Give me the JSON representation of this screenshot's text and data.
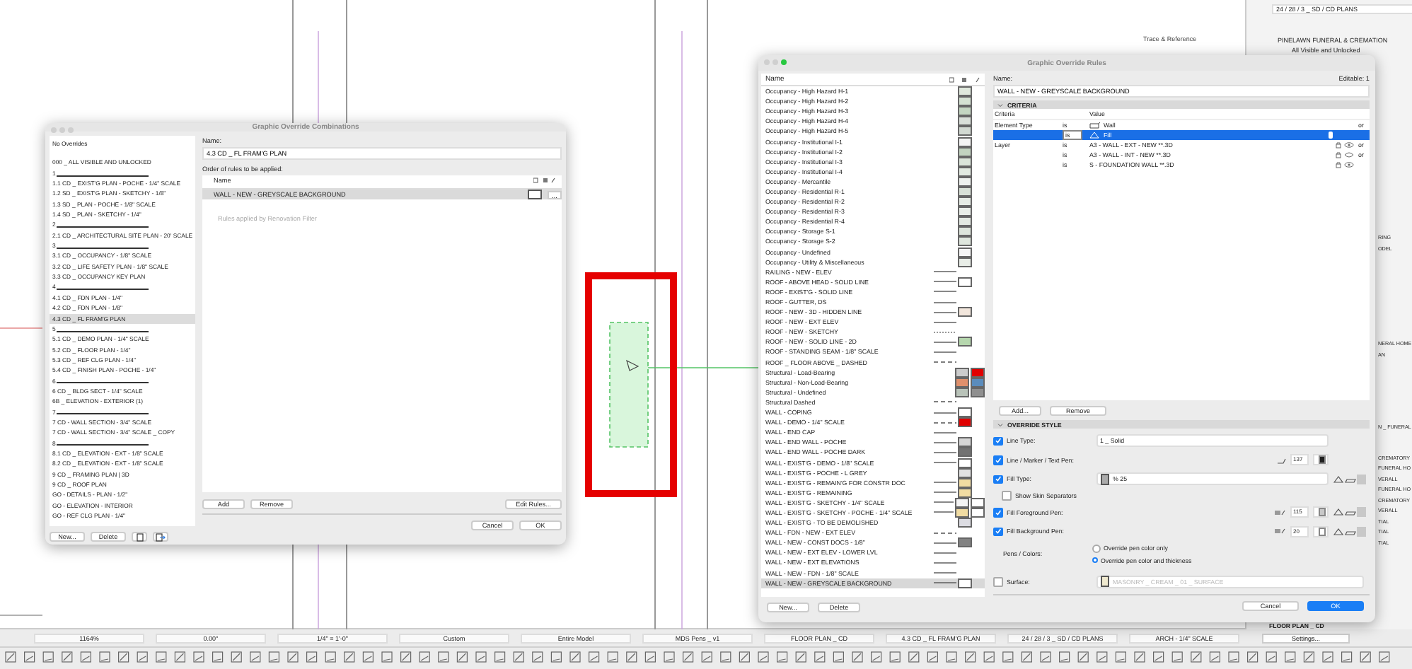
{
  "toolbar_top": {
    "label": "Trace & Reference"
  },
  "navigator": {
    "path": "24 / 28 / 3 _ SD / CD PLANS",
    "project": "PINELAWN FUNERAL & CREMATION",
    "combination": "All Visible and Unlocked",
    "cut_groups": [
      [
        "RING",
        "ODEL"
      ],
      [
        "NERAL HOME",
        "AN"
      ],
      [
        "N _ FUNERAL"
      ],
      [
        "CREMATORY",
        "FUNERAL HO",
        "VERALL",
        "FUNERAL HO",
        "CREMATORY",
        "VERALL",
        "TIAL",
        "TIAL",
        "TIAL"
      ]
    ],
    "view": "FLOOR PLAN _ CD",
    "settings": "Settings..."
  },
  "combinations": {
    "title": "Graphic Override Combinations",
    "no_overrides": "No Overrides",
    "items": [
      {
        "kind": "item",
        "label": "000 _ ALL VISIBLE AND UNLOCKED",
        "selected": false
      },
      {
        "kind": "separator",
        "label": "1",
        "selected": false
      },
      {
        "kind": "item",
        "label": "1.1 CD _ EXIST'G PLAN - POCHE - 1/4\" SCALE",
        "selected": false
      },
      {
        "kind": "item",
        "label": "1.2 SD _ EXIST'G PLAN - SKETCHY - 1/8\"",
        "selected": false
      },
      {
        "kind": "item",
        "label": "1.3 SD _ PLAN - POCHE - 1/8\" SCALE",
        "selected": false
      },
      {
        "kind": "item",
        "label": "1.4 SD _ PLAN - SKETCHY - 1/4\"",
        "selected": false
      },
      {
        "kind": "separator",
        "label": "2",
        "selected": false
      },
      {
        "kind": "item",
        "label": "2.1 CD _ ARCHITECTURAL SITE PLAN - 20' SCALE",
        "selected": false
      },
      {
        "kind": "separator",
        "label": "3",
        "selected": false
      },
      {
        "kind": "item",
        "label": "3.1 CD _ OCCUPANCY - 1/8\" SCALE",
        "selected": false
      },
      {
        "kind": "item",
        "label": "3.2 CD _ LIFE SAFETY PLAN - 1/8\" SCALE",
        "selected": false
      },
      {
        "kind": "item",
        "label": "3.3 CD _ OCCUPANCY KEY PLAN",
        "selected": false
      },
      {
        "kind": "separator",
        "label": "4",
        "selected": false
      },
      {
        "kind": "item",
        "label": "4.1 CD _ FDN PLAN - 1/4\"",
        "selected": false
      },
      {
        "kind": "item",
        "label": "4.2 CD _ FDN PLAN - 1/8\"",
        "selected": false
      },
      {
        "kind": "item",
        "label": "4.3 CD _ FL FRAM'G PLAN",
        "selected": true
      },
      {
        "kind": "separator",
        "label": "5",
        "selected": false
      },
      {
        "kind": "item",
        "label": "5.1 CD _ DEMO PLAN - 1/4\" SCALE",
        "selected": false
      },
      {
        "kind": "item",
        "label": "5.2 CD _ FLOOR PLAN - 1/4\"",
        "selected": false
      },
      {
        "kind": "item",
        "label": "5.3 CD _ REF CLG PLAN - 1/4\"",
        "selected": false
      },
      {
        "kind": "item",
        "label": "5.4 CD _ FINISH PLAN - POCHE - 1/4\"",
        "selected": false
      },
      {
        "kind": "separator",
        "label": "6",
        "selected": false
      },
      {
        "kind": "item",
        "label": "6 CD _ BLDG SECT - 1/4\" SCALE",
        "selected": false
      },
      {
        "kind": "item",
        "label": "6B _ ELEVATION - EXTERIOR (1)",
        "selected": false
      },
      {
        "kind": "separator",
        "label": "7",
        "selected": false
      },
      {
        "kind": "item",
        "label": "7 CD - WALL SECTION - 3/4\" SCALE",
        "selected": false
      },
      {
        "kind": "item",
        "label": "7 CD - WALL SECTION - 3/4\" SCALE _ COPY",
        "selected": false
      },
      {
        "kind": "separator",
        "label": "8",
        "selected": false
      },
      {
        "kind": "item",
        "label": "8.1 CD _ ELEVATION - EXT - 1/8\" SCALE",
        "selected": false
      },
      {
        "kind": "item",
        "label": "8.2 CD _ ELEVATION - EXT - 1/8\" SCALE",
        "selected": false
      },
      {
        "kind": "item",
        "label": "9 CD _ FRAMING PLAN | 3D",
        "selected": false
      },
      {
        "kind": "item",
        "label": "9 CD _ ROOF PLAN",
        "selected": false
      },
      {
        "kind": "item",
        "label": "GO - DETAILS - PLAN - 1/2\"",
        "selected": false
      },
      {
        "kind": "item",
        "label": "GO - ELEVATION - INTERIOR",
        "selected": false
      },
      {
        "kind": "item",
        "label": "GO - REF CLG PLAN - 1/4\"",
        "selected": false
      }
    ],
    "new": "New...",
    "delete": "Delete",
    "name_label": "Name:",
    "name_value": "4.3 CD _ FL FRAM'G PLAN",
    "order_label": "Order of rules to be applied:",
    "column": "Name",
    "rules": [
      {
        "name": "WALL - NEW - GREYSCALE BACKGROUND",
        "selected": true
      }
    ],
    "more": "...",
    "note": "Rules applied by Renovation Filter",
    "add": "Add",
    "remove": "Remove",
    "edit": "Edit Rules...",
    "cancel": "Cancel",
    "ok": "OK"
  },
  "rules_dialog": {
    "title": "Graphic Override Rules",
    "column": "Name",
    "items": [
      {
        "name": "Occupancy - High Hazard H-1",
        "kind": "fill",
        "swatches": [
          {
            "color": "#dfe8dc"
          }
        ],
        "selected": false
      },
      {
        "name": "Occupancy - High Hazard H-2",
        "kind": "fill",
        "swatches": [
          {
            "color": "#d5e2d3"
          }
        ],
        "selected": false
      },
      {
        "name": "Occupancy - High Hazard H-3",
        "kind": "fill",
        "swatches": [
          {
            "color": "#c4d6c2"
          }
        ],
        "selected": false
      },
      {
        "name": "Occupancy - High Hazard H-4",
        "kind": "fill",
        "swatches": [
          {
            "color": "#d9dfd9"
          }
        ],
        "selected": false
      },
      {
        "name": "Occupancy - High Hazard H-5",
        "kind": "fill",
        "swatches": [
          {
            "color": "#d2d9d2"
          }
        ],
        "selected": false
      },
      {
        "name": "Occupancy - Institutional I-1",
        "kind": "fill",
        "swatches": [
          {
            "color": "#f4f4f4"
          }
        ],
        "selected": false
      },
      {
        "name": "Occupancy - Institutional I-2",
        "kind": "fill",
        "swatches": [
          {
            "color": "#c2d3c0"
          }
        ],
        "selected": false
      },
      {
        "name": "Occupancy - Institutional I-3",
        "kind": "fill",
        "swatches": [
          {
            "color": "#dbe5da"
          }
        ],
        "selected": false
      },
      {
        "name": "Occupancy - Institutional I-4",
        "kind": "fill",
        "swatches": [
          {
            "color": "#e2eae1"
          }
        ],
        "selected": false
      },
      {
        "name": "Occupancy - Mercantile",
        "kind": "fill",
        "swatches": [
          {
            "color": "#eef1ee"
          }
        ],
        "selected": false
      },
      {
        "name": "Occupancy - Residential R-1",
        "kind": "fill",
        "swatches": [
          {
            "color": "#d8e1d7"
          }
        ],
        "selected": false
      },
      {
        "name": "Occupancy - Residential R-2",
        "kind": "fill",
        "swatches": [
          {
            "color": "#e6ece5"
          }
        ],
        "selected": false
      },
      {
        "name": "Occupancy - Residential R-3",
        "kind": "fill",
        "swatches": [
          {
            "color": "#e9eee8"
          }
        ],
        "selected": false
      },
      {
        "name": "Occupancy - Residential R-4",
        "kind": "fill",
        "swatches": [
          {
            "color": "#e3e9e2"
          }
        ],
        "selected": false
      },
      {
        "name": "Occupancy - Storage S-1",
        "kind": "fill",
        "swatches": [
          {
            "color": "#dde5dc"
          }
        ],
        "selected": false
      },
      {
        "name": "Occupancy - Storage S-2",
        "kind": "fill",
        "swatches": [
          {
            "color": "#dfe7de"
          }
        ],
        "selected": false
      },
      {
        "name": "Occupancy - Undefined",
        "kind": "fill",
        "swatches": [
          {
            "color": "#f6f6f6"
          }
        ],
        "selected": false
      },
      {
        "name": "Occupancy - Utility & Miscellaneous",
        "kind": "fill",
        "swatches": [
          {
            "color": "#e8ede7"
          }
        ],
        "selected": false
      },
      {
        "name": "RAILING - NEW - ELEV",
        "kind": "solid",
        "selected": false
      },
      {
        "name": "ROOF - ABOVE HEAD - SOLID LINE",
        "kind": "solid",
        "swatches": [
          {
            "color": "#ffffff"
          }
        ],
        "selected": false
      },
      {
        "name": "ROOF - EXIST'G - SOLID LINE",
        "kind": "solid",
        "selected": false
      },
      {
        "name": "ROOF - GUTTER, DS",
        "kind": "solid",
        "selected": false
      },
      {
        "name": "ROOF - NEW - 3D - HIDDEN LINE",
        "kind": "solid",
        "swatches": [
          {
            "color": "#f2e6dc"
          }
        ],
        "selected": false
      },
      {
        "name": "ROOF - NEW - EXT ELEV",
        "kind": "solid",
        "selected": false
      },
      {
        "name": "ROOF - NEW - SKETCHY",
        "kind": "dotted",
        "selected": false
      },
      {
        "name": "ROOF - NEW - SOLID LINE - 2D",
        "kind": "solid",
        "swatches": [
          {
            "color": "#b6d7ae"
          }
        ],
        "selected": false
      },
      {
        "name": "ROOF - STANDING SEAM - 1/8\" SCALE",
        "kind": "solid",
        "selected": false
      },
      {
        "name": "ROOF _ FLOOR ABOVE _ DASHED",
        "kind": "dashed",
        "selected": false
      },
      {
        "name": "Structural - Load-Bearing",
        "kind": "fill",
        "swatches": [
          {
            "color": "#cccccc"
          },
          {
            "color": "#e00000"
          }
        ],
        "selected": false
      },
      {
        "name": "Structural - Non-Load-Bearing",
        "kind": "fill",
        "swatches": [
          {
            "color": "#e0906c"
          },
          {
            "color": "#5b8cbc"
          }
        ],
        "selected": false
      },
      {
        "name": "Structural - Undefined",
        "kind": "fill",
        "swatches": [
          {
            "color": "#b9c3b9"
          },
          {
            "color": "#8f8f8f"
          }
        ],
        "selected": false
      },
      {
        "name": "Structural Dashed",
        "kind": "dashed",
        "selected": false
      },
      {
        "name": "WALL - COPING",
        "kind": "solid",
        "swatches": [
          {
            "color": "#ffffff"
          }
        ],
        "selected": false
      },
      {
        "name": "WALL - DEMO - 1/4\" SCALE",
        "kind": "dashed",
        "swatches": [
          {
            "color": "#e00000"
          }
        ],
        "selected": false
      },
      {
        "name": "WALL - END CAP",
        "kind": "solid",
        "selected": false
      },
      {
        "name": "WALL - END WALL - POCHE",
        "kind": "solid",
        "swatches": [
          {
            "color": "#d6d6d6"
          }
        ],
        "selected": false
      },
      {
        "name": "WALL - END WALL - POCHE DARK",
        "kind": "solid",
        "swatches": [
          {
            "color": "#727272"
          }
        ],
        "selected": false
      },
      {
        "name": "WALL - EXIST'G - DEMO - 1/8\" SCALE",
        "kind": "solid",
        "swatches": [
          {
            "color": "#ffffff"
          }
        ],
        "selected": false
      },
      {
        "name": "WALL - EXIST'G - POCHE - L GREY",
        "kind": "fill",
        "swatches": [
          {
            "color": "#e2e2e2"
          }
        ],
        "selected": false
      },
      {
        "name": "WALL - EXIST'G - REMAIN'G FOR CONSTR DOC",
        "kind": "solid",
        "swatches": [
          {
            "color": "#f1dca2"
          }
        ],
        "selected": false
      },
      {
        "name": "WALL - EXIST'G - REMAINING",
        "kind": "solid",
        "swatches": [
          {
            "color": "#f1dca2"
          }
        ],
        "selected": false
      },
      {
        "name": "WALL - EXIST'G - SKETCHY - 1/4\" SCALE",
        "kind": "solid",
        "swatches": [
          {
            "color": "#f4f4f4"
          },
          {
            "color": "#ffffff"
          }
        ],
        "selected": false
      },
      {
        "name": "WALL - EXIST'G - SKETCHY - POCHE - 1/4\" SCALE",
        "kind": "solid",
        "swatches": [
          {
            "color": "#f1dca2"
          },
          {
            "color": "#ffffff"
          }
        ],
        "selected": false
      },
      {
        "name": "WALL - EXIST'G - TO BE DEMOLISHED",
        "kind": "fill",
        "swatches": [
          {
            "color": "#dcdce2"
          }
        ],
        "selected": false
      },
      {
        "name": "WALL - FDN - NEW - EXT ELEV",
        "kind": "dashed",
        "selected": false
      },
      {
        "name": "WALL - NEW - CONST DOCS - 1/8\"",
        "kind": "solid",
        "swatches": [
          {
            "color": "#828282"
          }
        ],
        "selected": false
      },
      {
        "name": "WALL - NEW - EXT ELEV - LOWER LVL",
        "kind": "solid",
        "selected": false
      },
      {
        "name": "WALL - NEW - EXT ELEVATIONS",
        "kind": "solid",
        "selected": false
      },
      {
        "name": "WALL - NEW - FDN - 1/8\" SCALE",
        "kind": "solid",
        "selected": false
      },
      {
        "name": "WALL - NEW - GREYSCALE BACKGROUND",
        "kind": "solid",
        "swatches": [
          {
            "color": "#ffffff"
          }
        ],
        "selected": true
      }
    ],
    "new": "New...",
    "delete": "Delete",
    "name_label": "Name:",
    "editable": "Editable: 1",
    "name_value": "WALL - NEW - GREYSCALE BACKGROUND",
    "criteria_title": "CRITERIA",
    "criteria_col": "Criteria",
    "value_col": "Value",
    "criteria": [
      {
        "kind": "element",
        "criterion": "Element Type",
        "op": "is",
        "value": "Wall",
        "conj": "or",
        "selected": false
      },
      {
        "kind": "fill",
        "op": "is",
        "value": "Fill",
        "selected": true
      },
      {
        "kind": "layer",
        "criterion": "Layer",
        "op": "is",
        "value": "A3 - WALL - EXT - NEW **.3D",
        "visible": true,
        "conj": "or",
        "selected": false
      },
      {
        "kind": "layer",
        "op": "is",
        "value": "A3 - WALL - INT - NEW **.3D",
        "visible": false,
        "conj": "or",
        "selected": false
      },
      {
        "kind": "layer",
        "op": "is",
        "value": "S - FOUNDATION WALL **.3D",
        "visible": true,
        "selected": false
      }
    ],
    "add": "Add...",
    "remove": "Remove",
    "style_title": "OVERRIDE STYLE",
    "style": [
      {
        "kind": "select",
        "label": "Line Type:",
        "checked": true,
        "value": "1 _ Solid"
      },
      {
        "kind": "pen",
        "label": "Line / Marker / Text Pen:",
        "checked": true,
        "value": "137",
        "color": "#1e1e1e",
        "overrides": false
      },
      {
        "kind": "fill",
        "label": "Fill Type:",
        "checked": true,
        "value": "% 25"
      },
      {
        "kind": "option",
        "label": "Show Skin Separators",
        "checked": false
      },
      {
        "kind": "pen",
        "label": "Fill Foreground Pen:",
        "checked": true,
        "value": "115",
        "color": "#c8c8c8",
        "overrides": true
      },
      {
        "kind": "pen",
        "label": "Fill Background Pen:",
        "checked": true,
        "value": "20",
        "color": "#ffffff",
        "overrides": true
      }
    ],
    "pens_label": "Pens / Colors:",
    "pens_options": [
      {
        "label": "Override pen color only",
        "selected": false
      },
      {
        "label": "Override pen color and thickness",
        "selected": true
      }
    ],
    "surface": {
      "label": "Surface:",
      "checked": false,
      "value": "MASONRY _ CREAM _ 01 _ SURFACE"
    },
    "cancel": "Cancel",
    "ok": "OK"
  },
  "status_bar": [
    "1164%",
    "0.00°",
    "1/4\" = 1'-0\"",
    "Custom",
    "Entire Model",
    "MDS Pens _ v1",
    "FLOOR PLAN _ CD",
    "4.3 CD _ FL FRAM'G PLAN",
    "24 / 28 / 3 _ SD / CD PLANS",
    "ARCH - 1/4\" SCALE"
  ]
}
